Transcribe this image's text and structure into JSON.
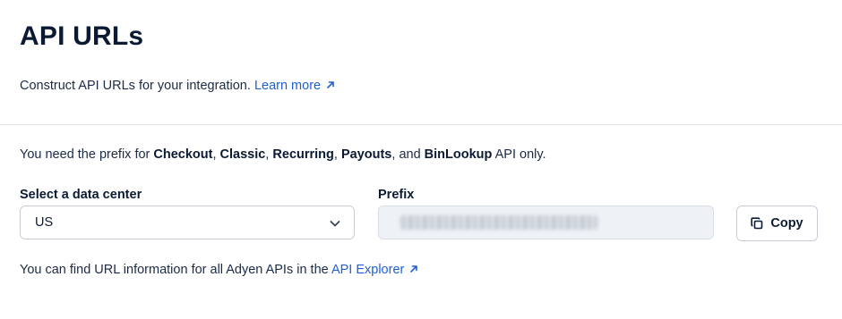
{
  "page": {
    "title": "API URLs",
    "subtitle_text": "Construct API URLs for your integration.",
    "learn_more_label": "Learn more"
  },
  "note": {
    "prefix_text": "You need the prefix for ",
    "checkout": "Checkout",
    "sep1": ", ",
    "classic": "Classic",
    "sep2": ", ",
    "recurring": "Recurring",
    "sep3": ", ",
    "payouts": "Payouts",
    "sep4": ", and ",
    "binlookup": "BinLookup",
    "suffix_text": " API only."
  },
  "data_center": {
    "label": "Select a data center",
    "selected": "US"
  },
  "prefix_field": {
    "label": "Prefix",
    "value_redacted": true
  },
  "copy_button": {
    "label": "Copy",
    "icon": "copy-icon"
  },
  "footer": {
    "text": "You can find URL information for all Adyen APIs in the",
    "link_label": "API Explorer"
  },
  "colors": {
    "link": "#1f5fd6",
    "text": "#0b1a33",
    "divider": "#dfe3e8",
    "prefix_bg": "#eef1f5"
  }
}
